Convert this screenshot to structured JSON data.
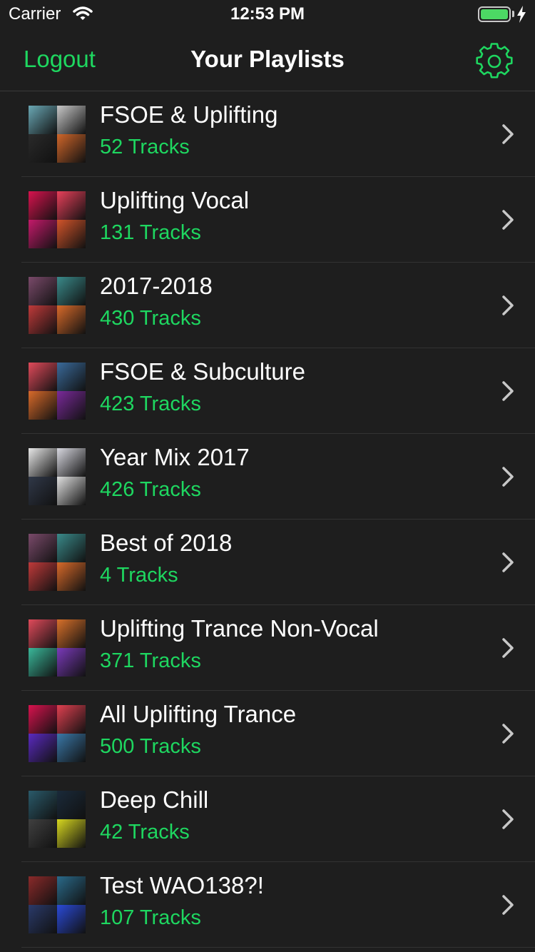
{
  "status_bar": {
    "carrier": "Carrier",
    "time": "12:53 PM"
  },
  "nav": {
    "logout_label": "Logout",
    "title": "Your Playlists",
    "settings_icon": "gear-icon"
  },
  "colors": {
    "accent": "#1ed760",
    "background": "#1e1e1e"
  },
  "playlists": [
    {
      "title": "FSOE & Uplifting",
      "tracks": "52 Tracks",
      "art": [
        "#6aa8b5",
        "#c8c8c8",
        "#2a2a2a",
        "#d0662a"
      ]
    },
    {
      "title": "Uplifting Vocal",
      "tracks": "131 Tracks",
      "art": [
        "#d8124e",
        "#e8405a",
        "#c41a6a",
        "#d2542a"
      ]
    },
    {
      "title": "2017-2018",
      "tracks": "430 Tracks",
      "art": [
        "#7a4a6a",
        "#3a8a8a",
        "#c03a3a",
        "#d86a2a"
      ]
    },
    {
      "title": "FSOE & Subculture",
      "tracks": "423 Tracks",
      "art": [
        "#e04a5a",
        "#3a6a9a",
        "#d86a2a",
        "#7a2a9a"
      ]
    },
    {
      "title": "Year Mix 2017",
      "tracks": "426 Tracks",
      "art": [
        "#e8e8e8",
        "#d8d8e0",
        "#303848",
        "#e0e0e0"
      ]
    },
    {
      "title": "Best of 2018",
      "tracks": "4 Tracks",
      "art": [
        "#7a4a6a",
        "#3a8a8a",
        "#c03a3a",
        "#d86a2a"
      ]
    },
    {
      "title": "Uplifting Trance Non-Vocal",
      "tracks": "371 Tracks",
      "art": [
        "#e04a5a",
        "#d8702a",
        "#3ab89a",
        "#7a3aba"
      ]
    },
    {
      "title": "All Uplifting Trance",
      "tracks": "500 Tracks",
      "art": [
        "#d8124e",
        "#e04050",
        "#5a2ac0",
        "#3a78a8"
      ]
    },
    {
      "title": "Deep Chill",
      "tracks": "42 Tracks",
      "art": [
        "#2a5a6a",
        "#1a2a3a",
        "#404040",
        "#d8d820"
      ]
    },
    {
      "title": "Test WAO138?!",
      "tracks": "107 Tracks",
      "art": [
        "#8a2a2a",
        "#2a6a8a",
        "#2a3a6a",
        "#2a4ad8"
      ]
    }
  ]
}
